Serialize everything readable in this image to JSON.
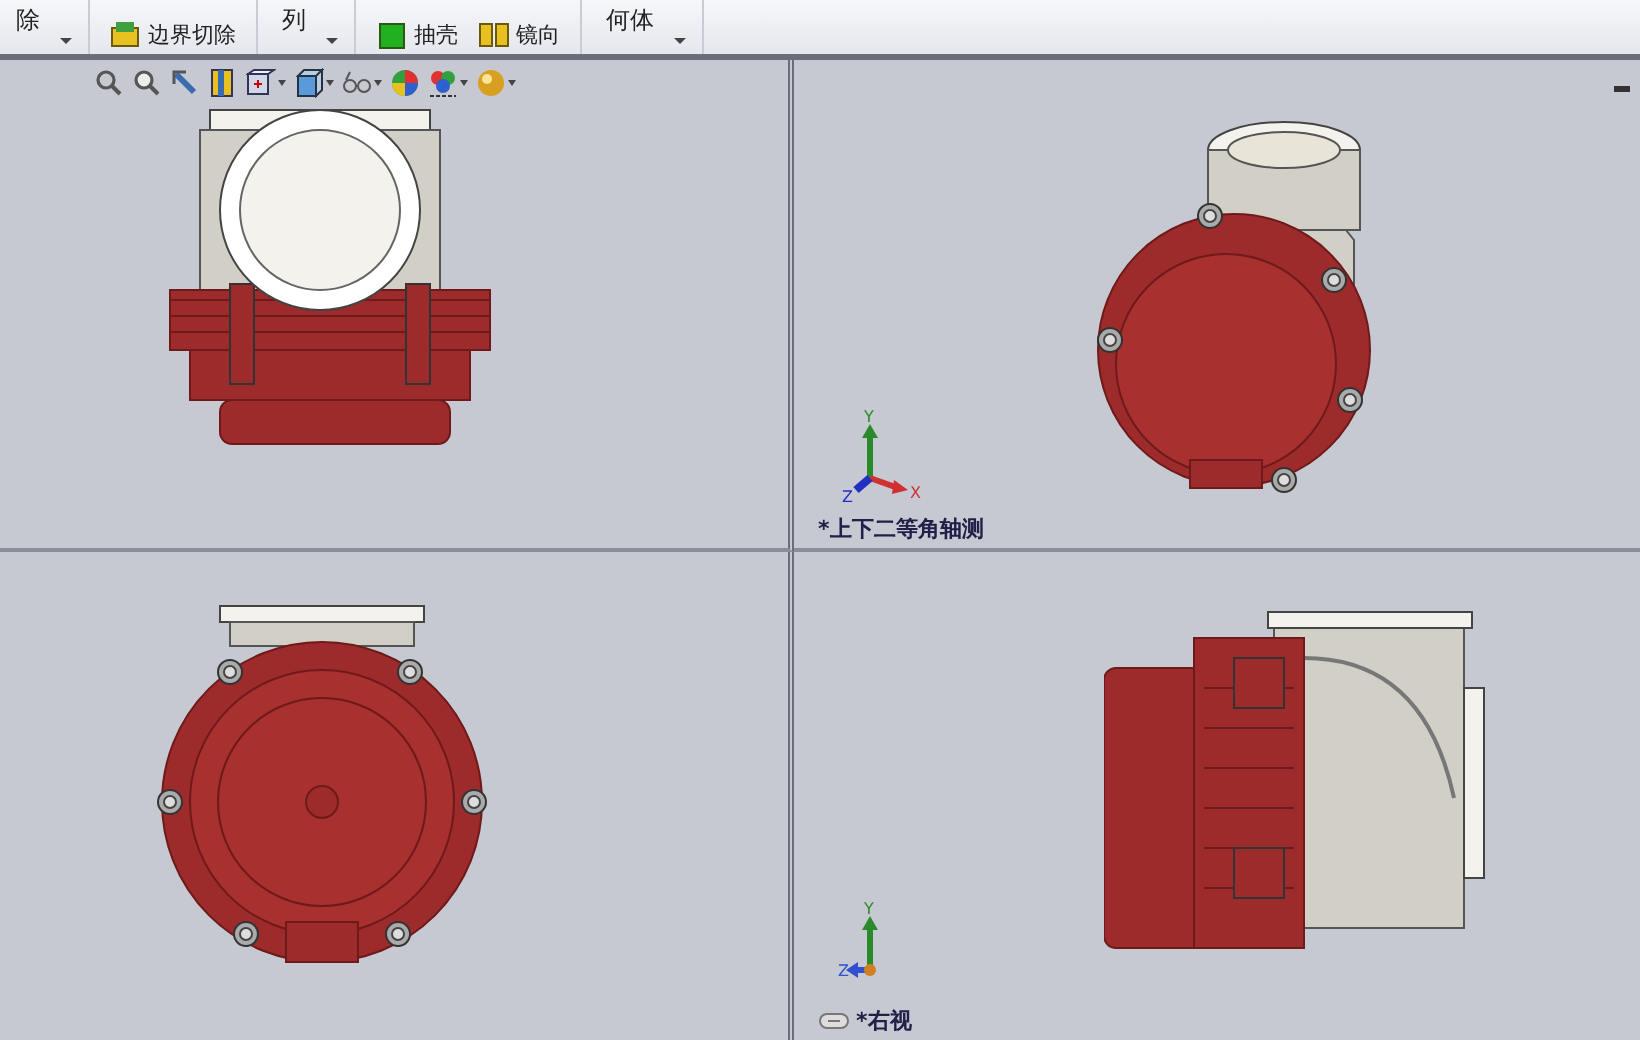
{
  "ribbon": {
    "groups": [
      {
        "items": [
          {
            "label": "除",
            "kind": "large"
          }
        ]
      },
      {
        "items": [
          {
            "label": "边界切除",
            "kind": "small"
          }
        ]
      },
      {
        "items": [
          {
            "label": "列",
            "kind": "large"
          }
        ]
      },
      {
        "items": [
          {
            "label": "抽壳",
            "kind": "small"
          },
          {
            "label": "镜向",
            "kind": "small"
          }
        ]
      },
      {
        "items": [
          {
            "label": "何体",
            "kind": "large"
          }
        ]
      }
    ]
  },
  "viewports": [
    {
      "kind": "top"
    },
    {
      "kind": "isometric",
      "label": "*上下二等角轴测",
      "triad": {
        "kind": "xyz",
        "axes": [
          "Y",
          "X",
          "Z"
        ]
      }
    },
    {
      "kind": "front"
    },
    {
      "kind": "right",
      "label": "*右视",
      "triad": {
        "kind": "yz",
        "axes": [
          "Y",
          "Z"
        ]
      },
      "linked": true
    }
  ]
}
